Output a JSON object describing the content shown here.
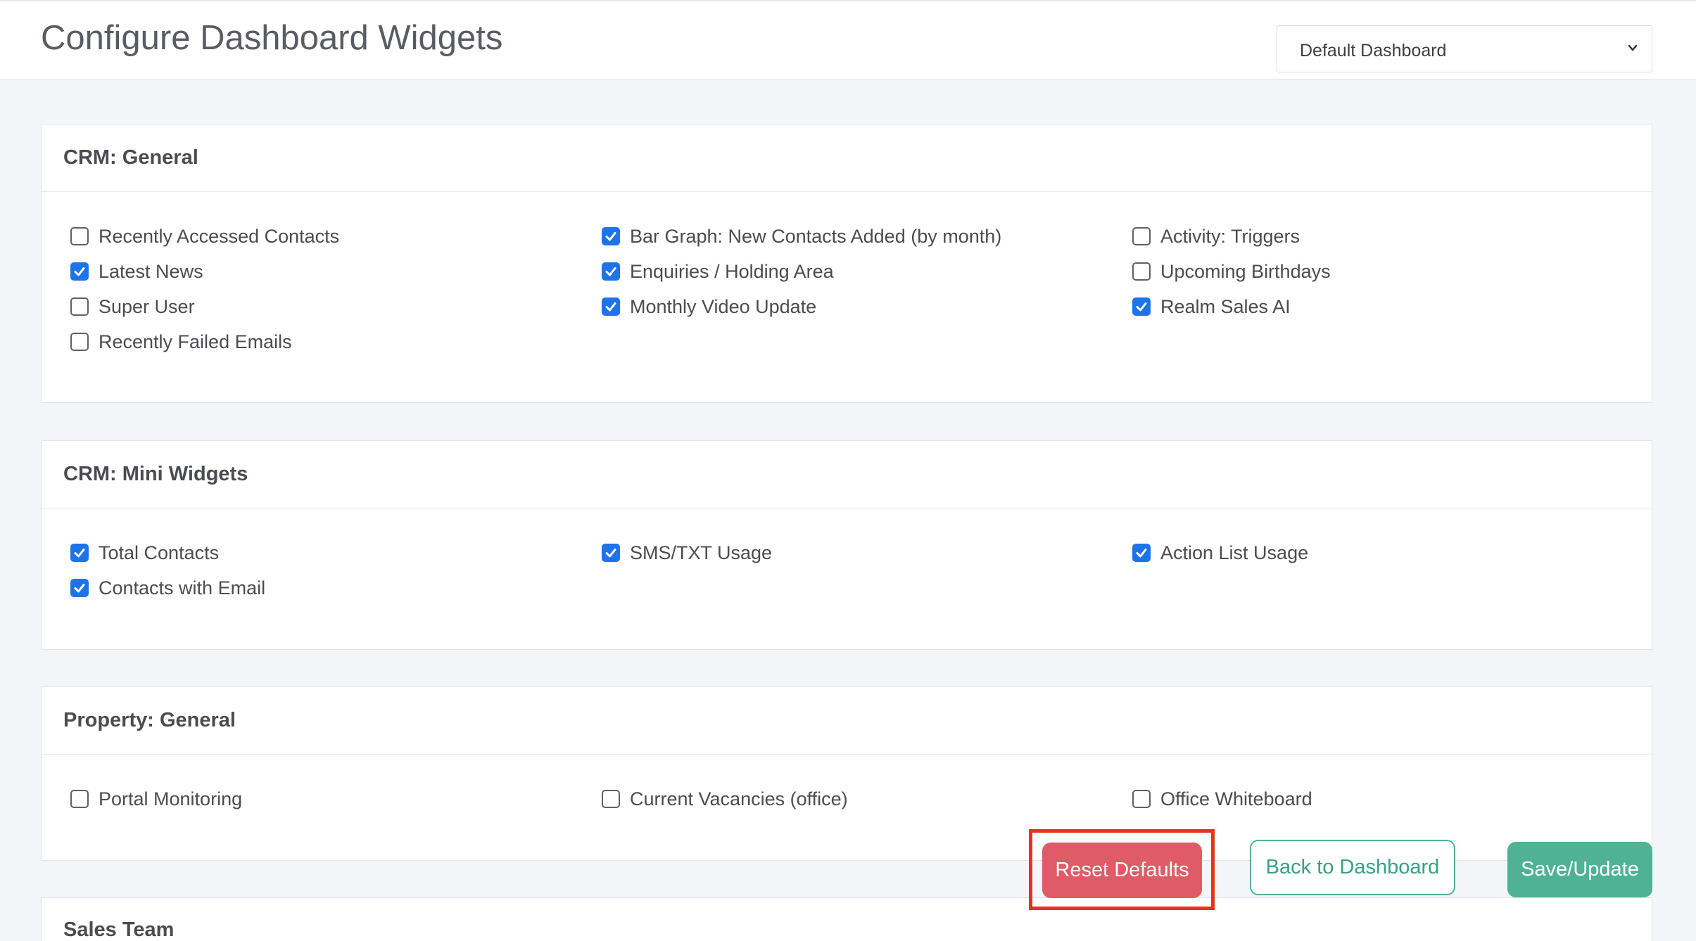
{
  "header": {
    "title": "Configure Dashboard Widgets",
    "dashboard_select": {
      "value": "Default Dashboard"
    }
  },
  "sections": [
    {
      "title": "CRM: General",
      "items": [
        {
          "label": "Recently Accessed Contacts",
          "checked": false
        },
        {
          "label": "Latest News",
          "checked": true
        },
        {
          "label": "Super User",
          "checked": false
        },
        {
          "label": "Recently Failed Emails",
          "checked": false
        },
        {
          "label": "Bar Graph: New Contacts Added (by month)",
          "checked": true
        },
        {
          "label": "Enquiries / Holding Area",
          "checked": true
        },
        {
          "label": "Monthly Video Update",
          "checked": true
        },
        {
          "label": "Activity: Triggers",
          "checked": false
        },
        {
          "label": "Upcoming Birthdays",
          "checked": false
        },
        {
          "label": "Realm Sales AI",
          "checked": true
        }
      ]
    },
    {
      "title": "CRM: Mini Widgets",
      "items": [
        {
          "label": "Total Contacts",
          "checked": true
        },
        {
          "label": "Contacts with Email",
          "checked": true
        },
        {
          "label": "SMS/TXT Usage",
          "checked": true
        },
        {
          "label": "Action List Usage",
          "checked": true
        }
      ]
    },
    {
      "title": "Property: General",
      "items": [
        {
          "label": "Portal Monitoring",
          "checked": false
        },
        {
          "label": "Current Vacancies (office)",
          "checked": false
        },
        {
          "label": "Office Whiteboard",
          "checked": false
        }
      ]
    },
    {
      "title": "Sales Team",
      "items": []
    }
  ],
  "actions": {
    "reset_label": "Reset Defaults",
    "back_label": "Back to Dashboard",
    "save_label": "Save/Update"
  },
  "colors": {
    "checkbox_checked": "#1d74e8",
    "reset_button": "#df5b67",
    "save_button": "#4fb393",
    "highlight_box": "#e2341f"
  }
}
